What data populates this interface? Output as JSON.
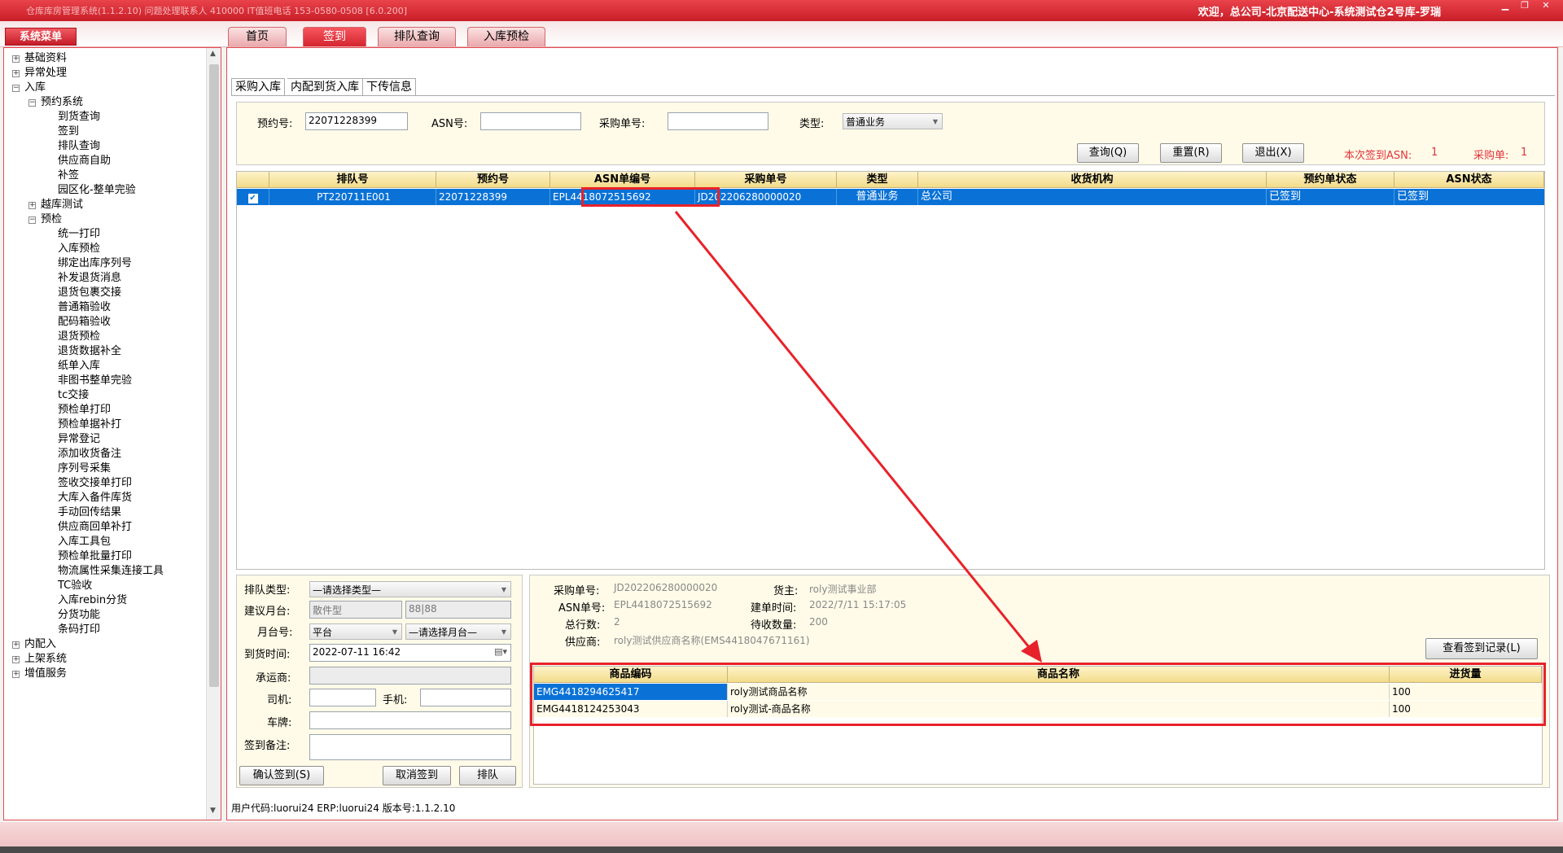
{
  "window": {
    "title": "仓库库房管理系统(1.1.2.10)   问题处理联系人   410000   IT值班电话   153-0580-0508 [6.0.200]",
    "welcome": "欢迎，总公司-北京配送中心-系统测试仓2号库-罗瑞",
    "controls": {
      "minimize": "▁",
      "maximize": "❐",
      "close": "✕"
    }
  },
  "sidebar": {
    "title": "系统菜单",
    "items": [
      {
        "label": "基础资料",
        "level": 0,
        "expander": "+"
      },
      {
        "label": "异常处理",
        "level": 0,
        "expander": "+"
      },
      {
        "label": "入库",
        "level": 0,
        "expander": "−"
      },
      {
        "label": "预约系统",
        "level": 1,
        "expander": "−"
      },
      {
        "label": "到货查询",
        "level": 2
      },
      {
        "label": "签到",
        "level": 2
      },
      {
        "label": "排队查询",
        "level": 2
      },
      {
        "label": "供应商自助",
        "level": 2
      },
      {
        "label": "补签",
        "level": 2
      },
      {
        "label": "园区化-整单完验",
        "level": 2
      },
      {
        "label": "越库测试",
        "level": 1,
        "expander": "+"
      },
      {
        "label": "预检",
        "level": 1,
        "expander": "−"
      },
      {
        "label": "统一打印",
        "level": 2
      },
      {
        "label": "入库预检",
        "level": 2
      },
      {
        "label": "绑定出库序列号",
        "level": 2
      },
      {
        "label": "补发退货消息",
        "level": 2
      },
      {
        "label": "退货包裹交接",
        "level": 2
      },
      {
        "label": "普通箱验收",
        "level": 2
      },
      {
        "label": "配码箱验收",
        "level": 2
      },
      {
        "label": "退货预检",
        "level": 2
      },
      {
        "label": "退货数据补全",
        "level": 2
      },
      {
        "label": "纸单入库",
        "level": 2
      },
      {
        "label": "非图书整单完验",
        "level": 2
      },
      {
        "label": "tc交接",
        "level": 2
      },
      {
        "label": "预检单打印",
        "level": 2
      },
      {
        "label": "预检单据补打",
        "level": 2
      },
      {
        "label": "异常登记",
        "level": 2
      },
      {
        "label": "添加收货备注",
        "level": 2
      },
      {
        "label": "序列号采集",
        "level": 2
      },
      {
        "label": "签收交接单打印",
        "level": 2
      },
      {
        "label": "大库入备件库货",
        "level": 2
      },
      {
        "label": "手动回传结果",
        "level": 2
      },
      {
        "label": "供应商回单补打",
        "level": 2
      },
      {
        "label": "入库工具包",
        "level": 2
      },
      {
        "label": "预检单批量打印",
        "level": 2
      },
      {
        "label": "物流属性采集连接工具",
        "level": 2
      },
      {
        "label": "TC验收",
        "level": 2
      },
      {
        "label": "入库rebin分货",
        "level": 2
      },
      {
        "label": "分货功能",
        "level": 2
      },
      {
        "label": "条码打印",
        "level": 2
      },
      {
        "label": "内配入",
        "level": 0,
        "expander": "+"
      },
      {
        "label": "上架系统",
        "level": 0,
        "expander": "+"
      },
      {
        "label": "增值服务",
        "level": 0,
        "expander": "+"
      }
    ]
  },
  "top_tabs": [
    "首页",
    "签到",
    "排队查询",
    "入库预检"
  ],
  "active_top_tab": "签到",
  "sub_tabs": [
    "采购入库",
    "内配到货入库",
    "下传信息"
  ],
  "search": {
    "reservation_label": "预约号:",
    "reservation_value": "22071228399",
    "asn_label": "ASN号:",
    "asn_value": "",
    "po_label": "采购单号:",
    "po_value": "",
    "type_label": "类型:",
    "type_value": "普通业务",
    "query_button": "查询(Q)",
    "reset_button": "重置(R)",
    "exit_button": "退出(X)",
    "signed_asn_label": "本次签到ASN:",
    "signed_asn_count": "1",
    "po_count_label": "采购单:",
    "po_count": "1"
  },
  "main_grid": {
    "columns": [
      "",
      "排队号",
      "预约号",
      "ASN单编号",
      "采购单号",
      "类型",
      "收货机构",
      "预约单状态",
      "ASN状态"
    ],
    "rows": [
      {
        "checked": "✔",
        "queue_no": "PT220711E001",
        "reservation_no": "22071228399",
        "asn_no": "EPL4418072515692",
        "po_no": "JD202206280000020",
        "type": "普通业务",
        "org": "总公司",
        "res_status": "已签到",
        "asn_status": "已签到"
      }
    ]
  },
  "signin_form": {
    "queue_type_label": "排队类型:",
    "queue_type_value": "—请选择类型—",
    "suggest_dock_label": "建议月台:",
    "suggest_dock_value": "散件型",
    "suggest_dock_value2": "88|88",
    "dock_no_label": "月台号:",
    "dock_no_value": "平台",
    "dock_no_select": "—请选择月台—",
    "arrival_label": "到货时间:",
    "arrival_value": "2022-07-11 16:42",
    "carrier_label": "承运商:",
    "carrier_value": "",
    "driver_label": "司机:",
    "driver_value": "",
    "phone_label": "手机:",
    "phone_value": "",
    "plate_label": "车牌:",
    "plate_value": "",
    "remark_label": "签到备注:",
    "remark_value": "",
    "confirm_button": "确认签到(S)",
    "cancel_button": "取消签到",
    "queue_button": "排队"
  },
  "detail": {
    "po_label": "采购单号:",
    "po_value": "JD202206280000020",
    "owner_label": "货主:",
    "owner_value": "roly测试事业部",
    "asn_label": "ASN单号:",
    "asn_value": "EPL4418072515692",
    "created_label": "建单时间:",
    "created_value": "2022/7/11 15:17:05",
    "lines_label": "总行数:",
    "lines_value": "2",
    "pending_label": "待收数量:",
    "pending_value": "200",
    "supplier_label": "供应商:",
    "supplier_value": "roly测试供应商名称(EMS4418047671161)",
    "history_button": "查看签到记录(L)"
  },
  "goods_grid": {
    "columns": [
      "商品编码",
      "商品名称",
      "进货量"
    ],
    "rows": [
      {
        "code": "EMG4418294625417",
        "name": "roly测试商品名称",
        "qty": "100"
      },
      {
        "code": "EMG4418124253043",
        "name": "roly测试-商品名称",
        "qty": "100"
      }
    ]
  },
  "status_bar": "用户代码:luorui24 ERP:luorui24 版本号:1.1.2.10",
  "colors": {
    "brand_red": "#d5252f",
    "selection_blue": "#0a72d6",
    "annotation_red": "#e8222a"
  }
}
